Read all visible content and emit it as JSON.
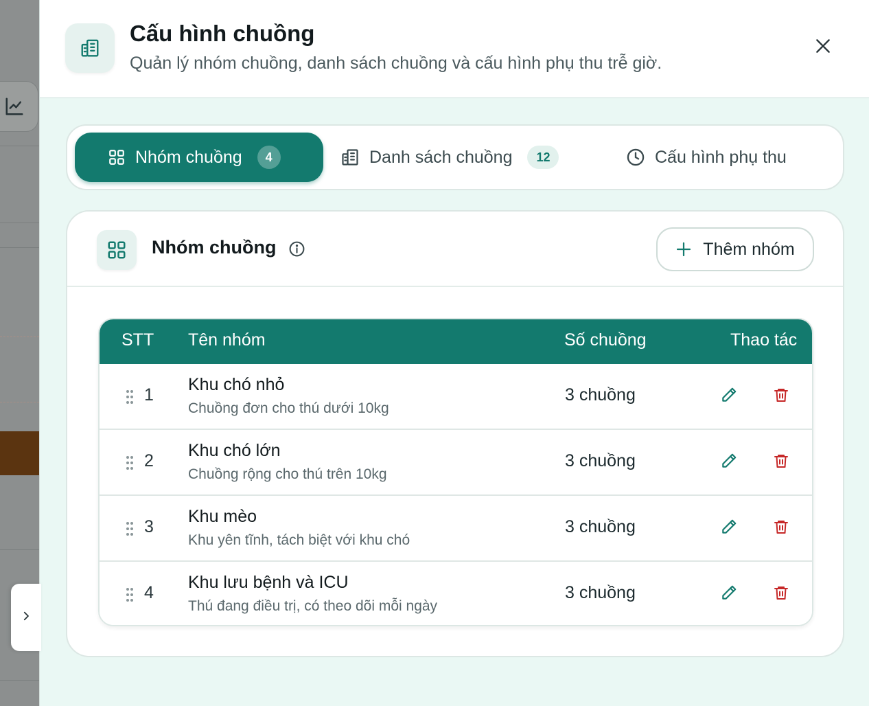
{
  "header": {
    "title": "Cấu hình chuồng",
    "subtitle": "Quản lý nhóm chuồng, danh sách chuồng và cấu hình phụ thu trễ giờ."
  },
  "tabs": [
    {
      "label": "Nhóm chuồng",
      "badge": "4",
      "icon": "grid-icon",
      "active": true
    },
    {
      "label": "Danh sách chuồng",
      "badge": "12",
      "icon": "building-icon",
      "active": false
    },
    {
      "label": "Cấu hình phụ thu",
      "badge": "",
      "icon": "clock-icon",
      "active": false
    }
  ],
  "section": {
    "title": "Nhóm chuồng",
    "add_label": "Thêm nhóm"
  },
  "table": {
    "columns": [
      "STT",
      "Tên nhóm",
      "Số chuồng",
      "Thao tác"
    ],
    "rows": [
      {
        "stt": "1",
        "name": "Khu chó nhỏ",
        "desc": "Chuồng đơn cho thú dưới 10kg",
        "count": "3 chuồng"
      },
      {
        "stt": "2",
        "name": "Khu chó lớn",
        "desc": "Chuồng rộng cho thú trên 10kg",
        "count": "3 chuồng"
      },
      {
        "stt": "3",
        "name": "Khu mèo",
        "desc": "Khu yên tĩnh, tách biệt với khu chó",
        "count": "3 chuồng"
      },
      {
        "stt": "4",
        "name": "Khu lưu bệnh và ICU",
        "desc": "Thú đang điều trị, có theo dõi mỗi ngày",
        "count": "3 chuồng"
      }
    ]
  },
  "colors": {
    "primary": "#137a6e",
    "danger": "#c62828",
    "panel_bg": "#eaf8f4"
  }
}
